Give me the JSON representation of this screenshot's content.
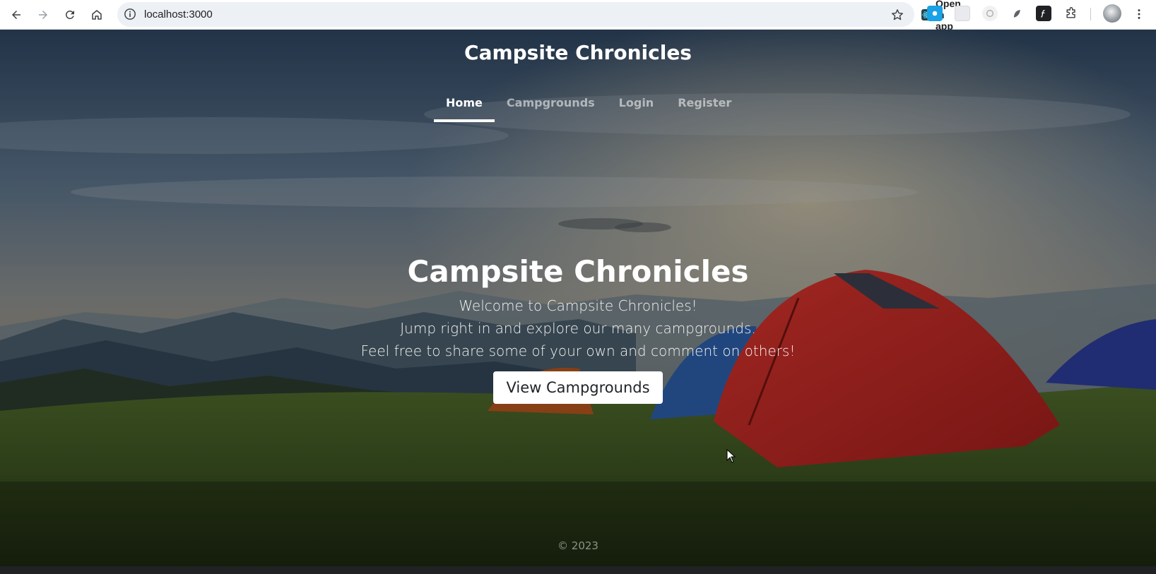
{
  "browser": {
    "url": "localhost:3000",
    "open_in_app_label": "Open in app",
    "icons": {
      "back": "arrow-left-icon",
      "forward": "arrow-right-icon",
      "reload": "reload-icon",
      "home": "home-icon",
      "site_info": "info-icon",
      "star": "star-icon",
      "extensions": "puzzle-icon",
      "menu": "kebab-menu-icon"
    }
  },
  "site": {
    "brand": "Campsite Chronicles",
    "nav": [
      {
        "label": "Home",
        "active": true
      },
      {
        "label": "Campgrounds",
        "active": false
      },
      {
        "label": "Login",
        "active": false
      },
      {
        "label": "Register",
        "active": false
      }
    ]
  },
  "hero": {
    "title": "Campsite Chronicles",
    "lines": [
      "Welcome to Campsite Chronicles!",
      "Jump right in and explore our many campgrounds.",
      "Feel free to share some of your own and comment on others!"
    ],
    "button_label": "View Campgrounds"
  },
  "footer": {
    "text": "© 2023"
  },
  "colors": {
    "nav_active": "#ffffff",
    "nav_inactive": "#9aa0a6",
    "button_bg": "#ffffff",
    "tent_red": "#c8302b",
    "tent_blue": "#2c5ea8",
    "grass": "#3f5a22"
  }
}
